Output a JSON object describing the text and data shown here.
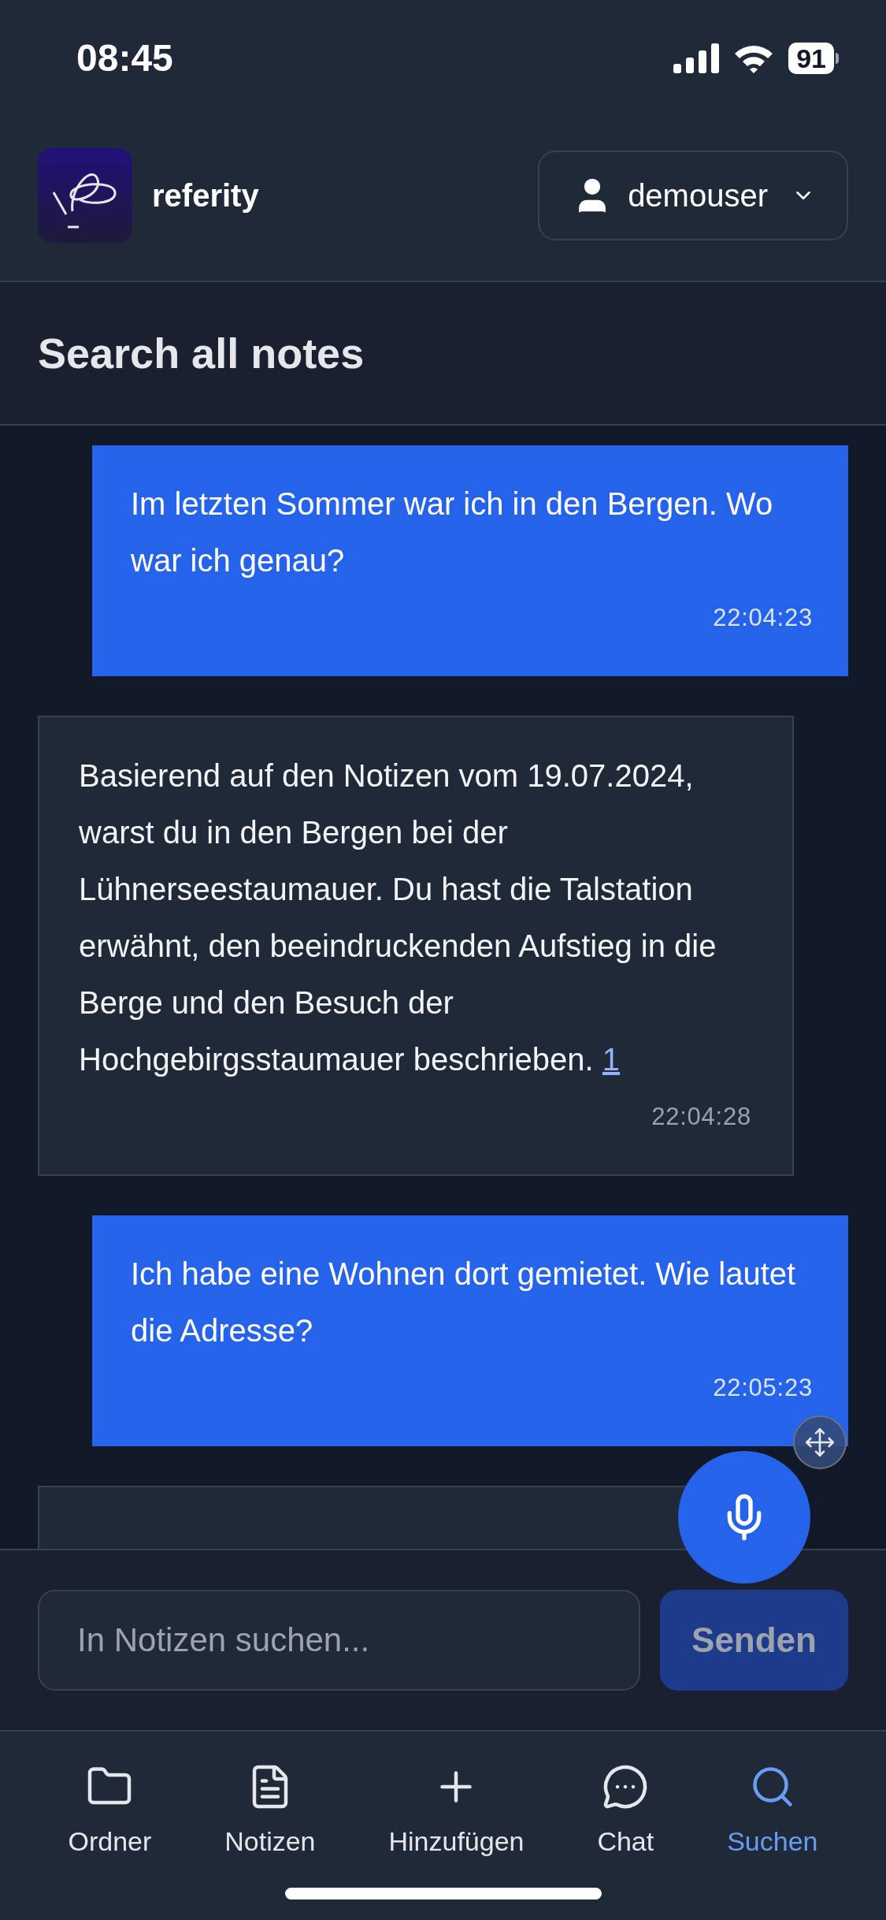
{
  "status_bar": {
    "time": "08:45",
    "battery": "91"
  },
  "header": {
    "app_name": "referity",
    "user_menu": {
      "label": "demouser"
    }
  },
  "page_title": "Search all notes",
  "messages": [
    {
      "kind": "user",
      "text": "Im letzten Sommer war ich in den Bergen. Wo war ich genau?",
      "time": "22:04:23"
    },
    {
      "kind": "assistant",
      "text": "Basierend auf den Notizen vom 19.07.2024, warst du in den Bergen bei der Lühnerseestaumauer. Du hast die Talstation erwähnt, den beeindruckenden Aufstieg in die Berge und den Besuch der Hochgebirgsstaumauer beschrieben.",
      "citation": "1",
      "time": "22:04:28"
    },
    {
      "kind": "user",
      "text": "Ich habe eine Wohnen dort gemietet. Wie lautet die Adresse?",
      "time": "22:05:23"
    }
  ],
  "search": {
    "placeholder": "In Notizen suchen...",
    "send_button": "Senden",
    "send_disabled": true
  },
  "nav": [
    {
      "label": "Ordner",
      "selected": false
    },
    {
      "label": "Notizen",
      "selected": false
    },
    {
      "label": "Hinzufügen",
      "selected": false
    },
    {
      "label": "Chat",
      "selected": false
    },
    {
      "label": "Suchen",
      "selected": true
    }
  ]
}
